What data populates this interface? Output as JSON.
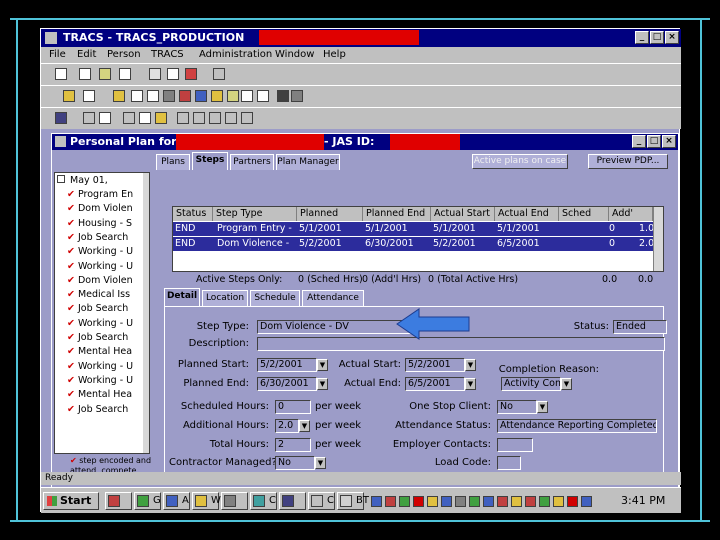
{
  "app": {
    "title": "TRACS - TRACS_PRODUCTION",
    "menu": [
      "File",
      "Edit",
      "Person",
      "TRACS",
      "Administration",
      "Window",
      "Help"
    ]
  },
  "child": {
    "title_prefix": "Personal Plan for",
    "title_suffix": "- JAS ID:",
    "top_tabs": [
      "Plans",
      "Steps",
      "Partners",
      "Plan Manager"
    ],
    "active_plans_button": "Active plans on case",
    "preview_button": "Preview PDP..."
  },
  "tree": {
    "root": "May 01,",
    "items": [
      "Program En",
      "Dom Violen",
      "Housing - S",
      "Job Search",
      "Working - U",
      "Working - U",
      "Dom Violen",
      "Medical Iss",
      "Job Search",
      "Working - U",
      "Job Search",
      "Mental Hea",
      "Working - U",
      "Working - U",
      "Mental Hea",
      "Job Search"
    ],
    "legend": "step encoded and attend. compete"
  },
  "grid": {
    "columns": [
      "Status",
      "Step Type",
      "Planned Start",
      "Planned End",
      "Actual Start",
      "Actual End",
      "Sched Hrs",
      "Add' Hrs"
    ],
    "rows": [
      {
        "status": "END",
        "step_type": "Program Entry -",
        "planned_start": "5/1/2001",
        "planned_end": "5/1/2001",
        "actual_start": "5/1/2001",
        "actual_end": "5/1/2001",
        "sched_hrs": "0",
        "add_hrs": "1.0"
      },
      {
        "status": "END",
        "step_type": "Dom Violence -",
        "planned_start": "5/2/2001",
        "planned_end": "6/30/2001",
        "actual_start": "5/2/2001",
        "actual_end": "6/5/2001",
        "sched_hrs": "0",
        "add_hrs": "2.0"
      }
    ],
    "totals": {
      "active_only": "Active Steps Only:",
      "sched": "0 (Sched Hrs)",
      "add": "0 (Add'l Hrs)",
      "total": "0 (Total Active Hrs)",
      "sum1": "0.0",
      "sum2": "0.0"
    }
  },
  "detail_tabs": [
    "Detail",
    "Location",
    "Schedule",
    "Attendance"
  ],
  "detail": {
    "step_type_label": "Step Type:",
    "step_type": "Dom Violence - DV",
    "status_label": "Status:",
    "status": "Ended",
    "description_label": "Description:",
    "description": "",
    "planned_start_label": "Planned Start:",
    "planned_start": "5/2/2001",
    "actual_start_label": "Actual Start:",
    "actual_start": "5/2/2001",
    "completion_reason_label": "Completion Reason:",
    "planned_end_label": "Planned End:",
    "planned_end": "6/30/2001",
    "actual_end_label": "Actual End:",
    "actual_end": "6/5/2001",
    "completion_reason": "Activity Comp",
    "scheduled_hours_label": "Scheduled Hours:",
    "scheduled_hours": "0",
    "per_week": "per week",
    "one_stop_label": "One Stop Client:",
    "one_stop": "No",
    "additional_hours_label": "Additional Hours:",
    "additional_hours": "2.0",
    "attendance_status_label": "Attendance Status:",
    "attendance_status": "Attendance Reporting Completed",
    "total_hours_label": "Total Hours:",
    "total_hours": "2",
    "employer_contacts_label": "Employer Contacts:",
    "employer_contacts": "",
    "contractor_managed_label": "Contractor Managed?",
    "contractor_managed": "No",
    "load_code_label": "Load Code:",
    "load_code": ""
  },
  "statusbar": {
    "text": "Ready"
  },
  "taskbar": {
    "start": "Start",
    "tasks": [
      "",
      "G",
      "A",
      "W",
      "",
      "C",
      "",
      "C",
      "BT"
    ],
    "clock": "3:41 PM"
  },
  "colors": {
    "background": "#000000",
    "window": "#9c9cc8",
    "title": "#000080",
    "arrow": "#3c7ce0",
    "redaction": "#e00000"
  }
}
